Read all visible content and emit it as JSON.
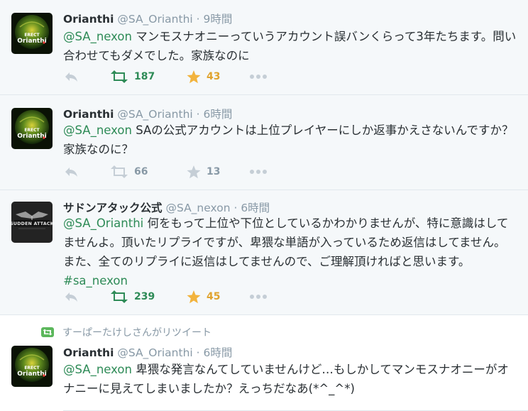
{
  "tweets": [
    {
      "name": "Orianthi",
      "handle": "@SA_Orianthi",
      "time": "· 9時間",
      "mention": "@SA_nexon",
      "text": " マンモスナオニーっていうアカウント誤バンくらって3年たちます。問い合わせてもダメでした。家族なのに",
      "retweets": "187",
      "favorites": "43",
      "avatar_label": "ERECT\nOrianthi"
    },
    {
      "name": "Orianthi",
      "handle": "@SA_Orianthi",
      "time": "· 6時間",
      "mention": "@SA_nexon",
      "text": " SAの公式アカウントは上位プレイヤーにしか返事かえさないんですか？家族なのに？",
      "retweets": "66",
      "favorites": "13"
    },
    {
      "name": "サドンアタック公式",
      "handle": "@SA_nexon",
      "time": "· 6時間",
      "mention": "@SA_Orianthi",
      "text": " 何をもって上位や下位としているかわかりませんが、特に意識はしてませんよ。頂いたリプライですが、卑猥な単語が入っているため返信はしてません。また、全てのリプライに返信はしてませんので、ご理解頂ければと思います。",
      "hashtag": "#sa_nexon",
      "retweets": "239",
      "favorites": "45",
      "avatar_label": "SUDDEN ATTACK"
    },
    {
      "retweeted_by": "すーぱーたけしさんがリツイート",
      "name": "Orianthi",
      "handle": "@SA_Orianthi",
      "time": "· 6時間",
      "mention": "@SA_nexon",
      "text": " 卑猥な発言なんてしていませんけど…もしかしてマンモスナオニーがオナニーに見えてしまいましたか？えっちだなあ(*^_^*)"
    }
  ],
  "colors": {
    "mention": "#2e8b57",
    "retweet_active": "#2e8b57",
    "favorite_active": "#e0a32e",
    "muted": "#8899a6"
  },
  "icons": [
    "reply-icon",
    "retweet-icon",
    "star-icon",
    "more-icon"
  ]
}
